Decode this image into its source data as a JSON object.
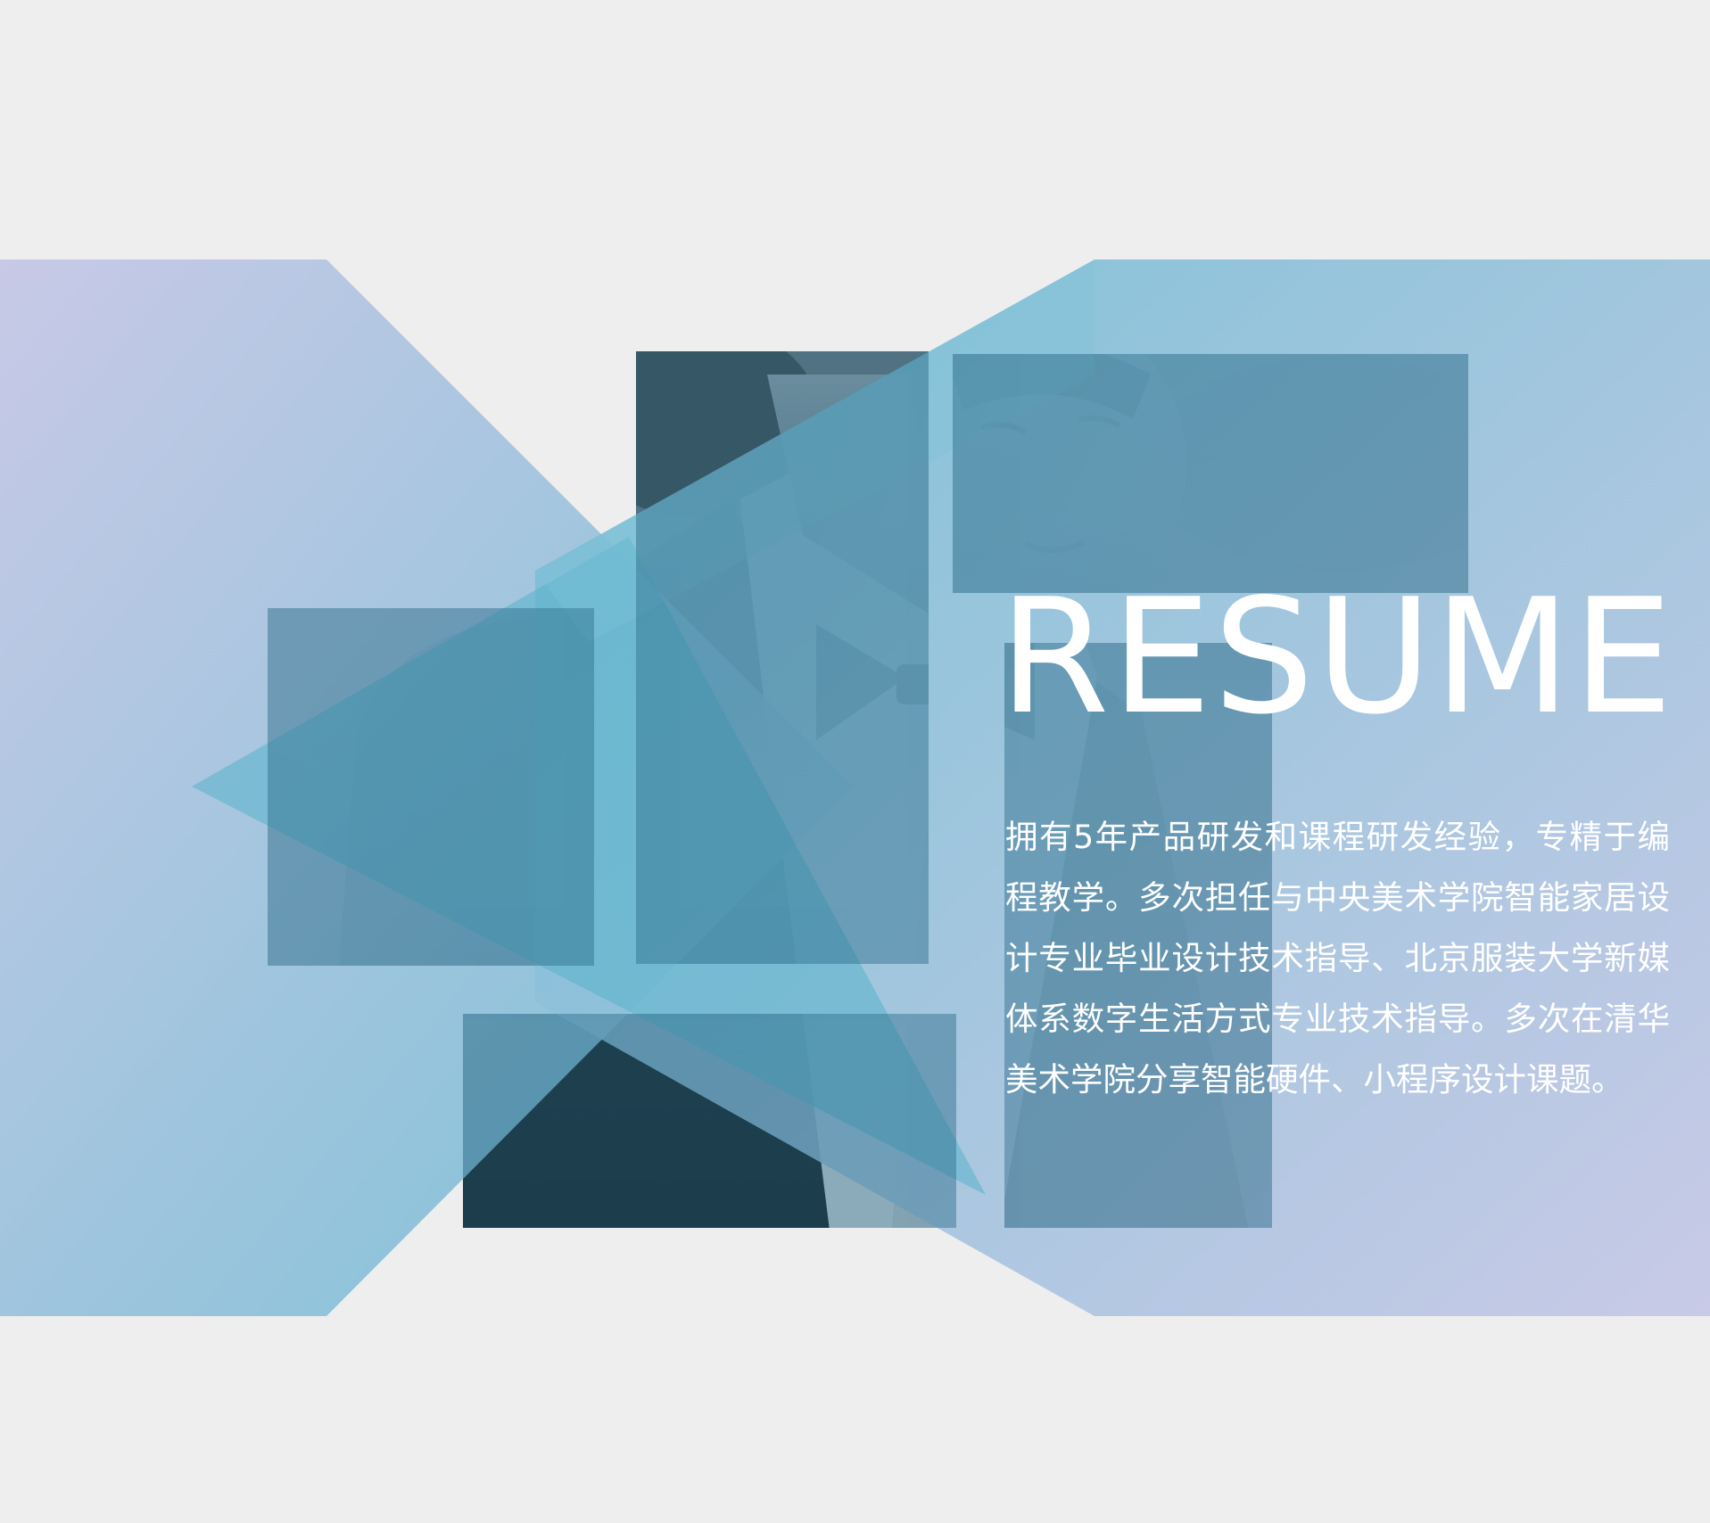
{
  "slide": {
    "title": "RESUME",
    "description": "拥有5年产品研发和课程研发经验，专精于编程教学。多次担任与中央美术学院智能家居设计专业毕业设计技术指导、北京服装大学新媒体系数字生活方式专业技术指导。多次在清华美术学院分享智能硬件、小程序设计课题。"
  },
  "colors": {
    "background": "#eeeeee",
    "gradient_lavender": "#c4c6e6",
    "gradient_teal": "#6fbdd3",
    "photo_tint": "#2e6e8c",
    "text": "#ffffff"
  },
  "images": {
    "photo_tiles": "portrait-photo-fragments"
  }
}
